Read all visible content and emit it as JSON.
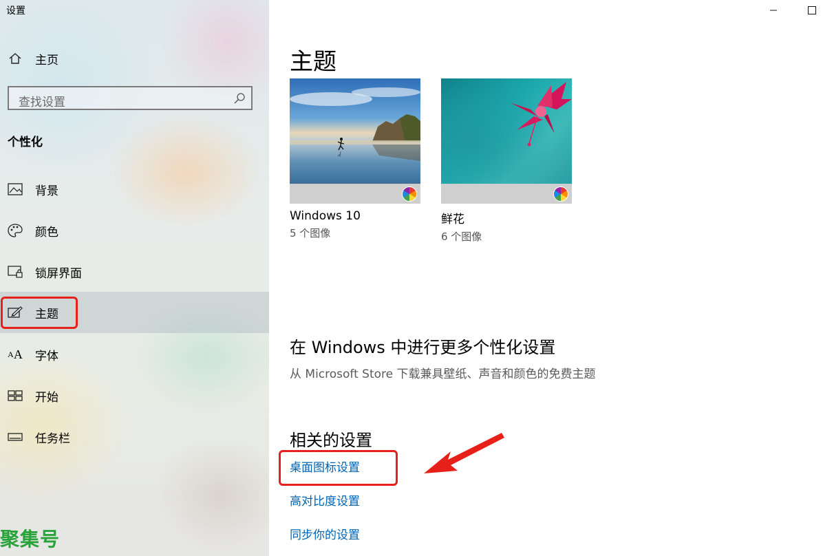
{
  "window": {
    "title": "设置"
  },
  "sidebar": {
    "home_label": "主页",
    "search_placeholder": "查找设置",
    "section_header": "个性化",
    "items": [
      {
        "label": "背景",
        "icon": "image-icon"
      },
      {
        "label": "颜色",
        "icon": "palette-icon"
      },
      {
        "label": "锁屏界面",
        "icon": "lock-screen-icon"
      },
      {
        "label": "主题",
        "icon": "theme-brush-icon",
        "selected": true
      },
      {
        "label": "字体",
        "icon": "font-icon"
      },
      {
        "label": "开始",
        "icon": "start-icon"
      },
      {
        "label": "任务栏",
        "icon": "taskbar-icon"
      }
    ]
  },
  "main": {
    "title": "主题",
    "themes": [
      {
        "name": "Windows 10",
        "count": "5 个图像"
      },
      {
        "name": "鲜花",
        "count": "6 个图像"
      }
    ],
    "more": {
      "heading": "在 Windows 中进行更多个性化设置",
      "subtext": "从 Microsoft Store 下载兼具壁纸、声音和颜色的免费主题"
    },
    "related": {
      "heading": "相关的设置",
      "links": [
        "桌面图标设置",
        "高对比度设置",
        "同步你的设置"
      ]
    }
  },
  "watermark": "聚集号",
  "colors": {
    "accent_link": "#0063b1",
    "highlight_red": "#e8201a",
    "watermark_green": "#27a33a"
  }
}
